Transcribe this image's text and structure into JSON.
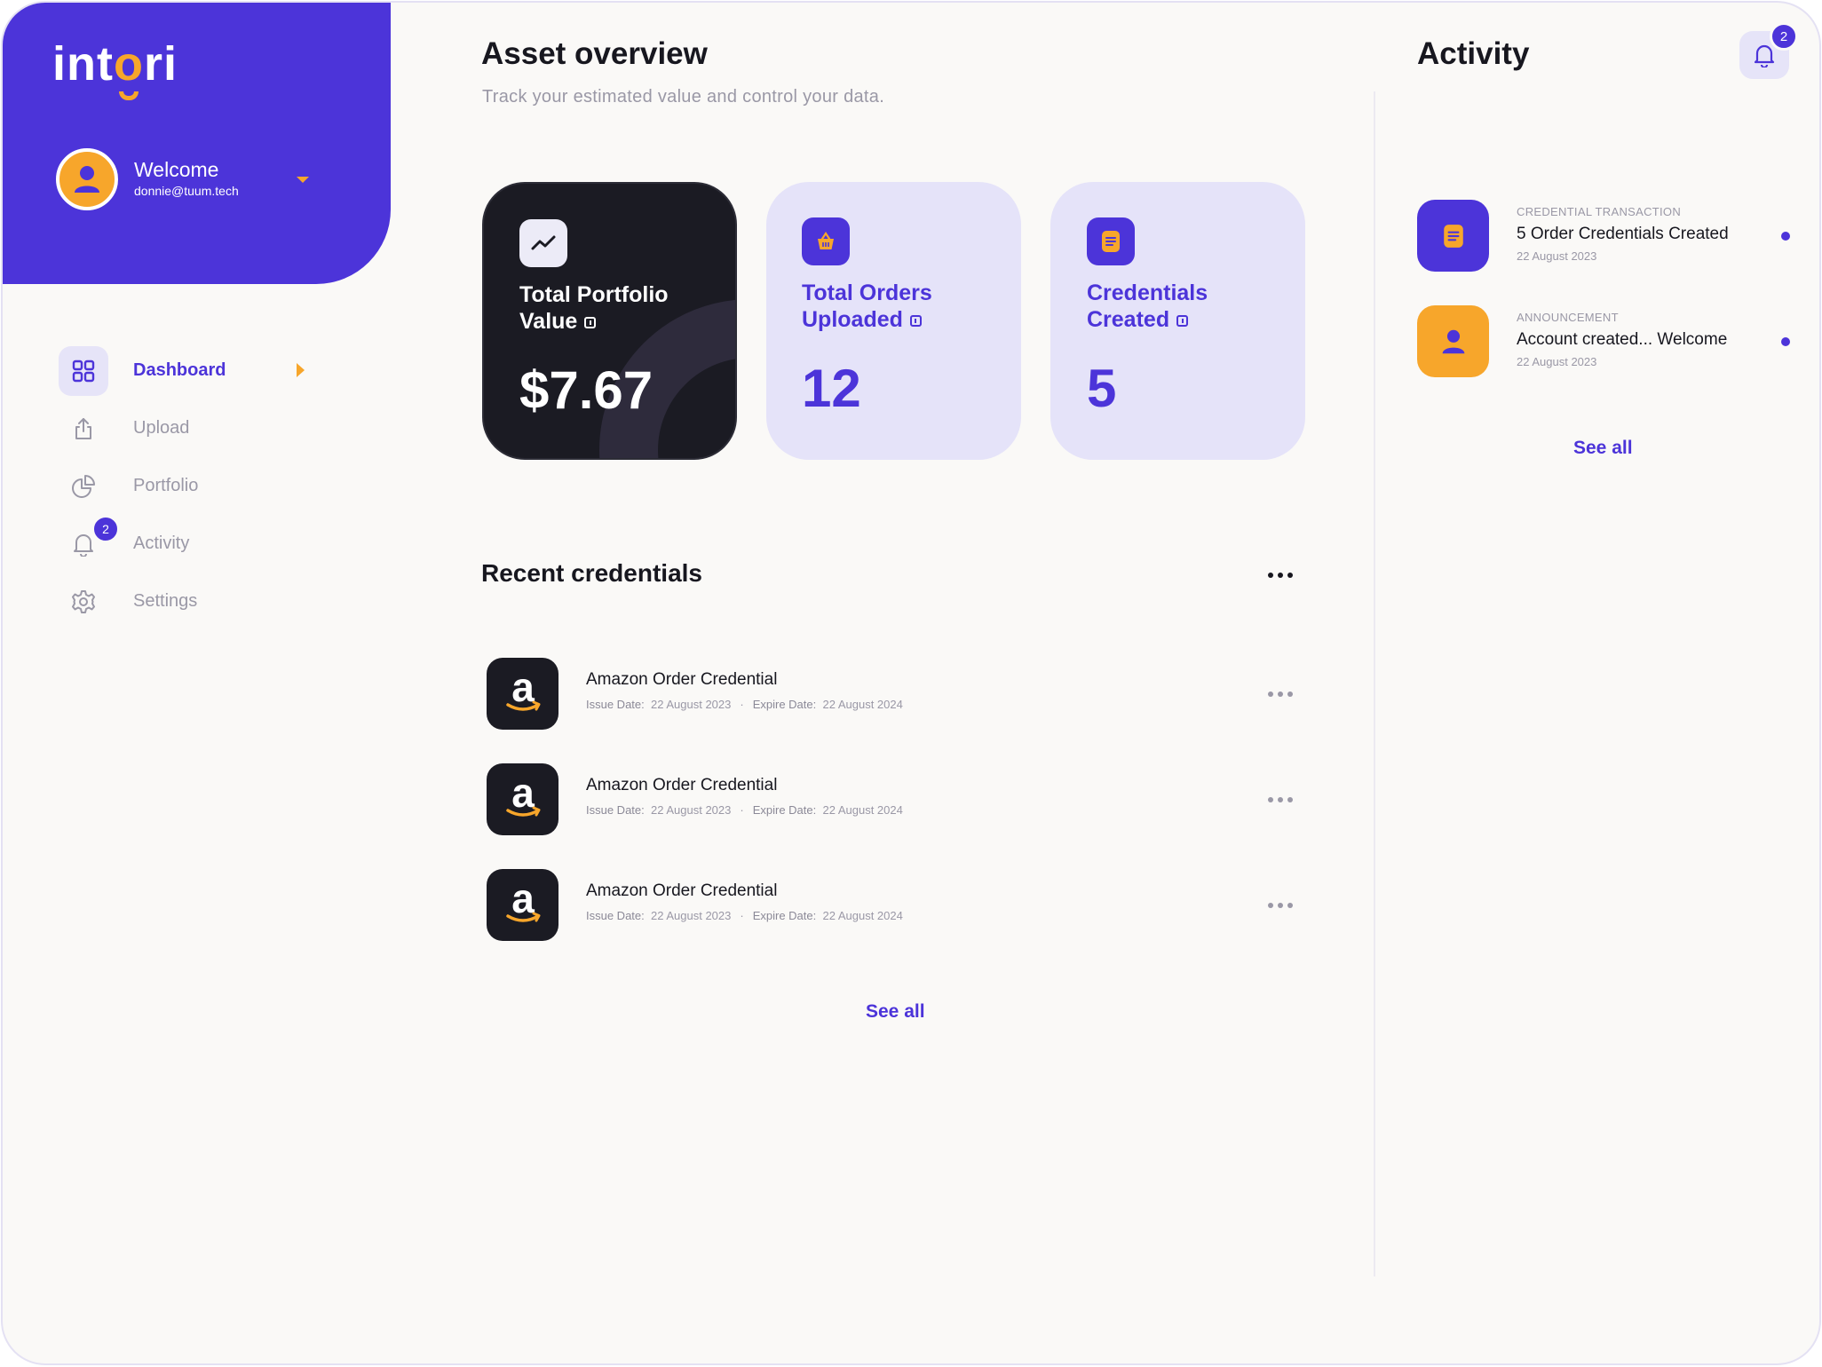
{
  "brand": {
    "logo_pre": "int",
    "logo_o": "o",
    "logo_post": "ri"
  },
  "user": {
    "welcome": "Welcome",
    "email": "donnie@tuum.tech"
  },
  "nav": [
    {
      "label": "Dashboard",
      "icon": "grid-icon",
      "active": true
    },
    {
      "label": "Upload",
      "icon": "upload-icon"
    },
    {
      "label": "Portfolio",
      "icon": "pie-chart-icon"
    },
    {
      "label": "Activity",
      "icon": "bell-icon",
      "badge": "2"
    },
    {
      "label": "Settings",
      "icon": "gear-icon"
    }
  ],
  "overview": {
    "title": "Asset overview",
    "subtitle": "Track your estimated value and control your data."
  },
  "stats": [
    {
      "line1": "Total Portfolio",
      "line2": "Value",
      "value": "$7.67",
      "icon": "trend-icon"
    },
    {
      "line1": "Total Orders",
      "line2": "Uploaded",
      "value": "12",
      "icon": "basket-icon"
    },
    {
      "line1": "Credentials",
      "line2": "Created",
      "value": "5",
      "icon": "document-icon"
    }
  ],
  "recent": {
    "title": "Recent credentials",
    "see_all": "See all",
    "items": [
      {
        "name": "Amazon Order Credential",
        "issue_label": "Issue Date:",
        "issue_date": "22 August 2023",
        "expire_label": "Expire Date:",
        "expire_date": "22 August 2024"
      },
      {
        "name": "Amazon Order Credential",
        "issue_label": "Issue Date:",
        "issue_date": "22 August 2023",
        "expire_label": "Expire Date:",
        "expire_date": "22 August 2024"
      },
      {
        "name": "Amazon Order Credential",
        "issue_label": "Issue Date:",
        "issue_date": "22 August 2023",
        "expire_label": "Expire Date:",
        "expire_date": "22 August 2024"
      }
    ]
  },
  "activity": {
    "title": "Activity",
    "badge": "2",
    "see_all": "See all",
    "items": [
      {
        "category": "CREDENTIAL TRANSACTION",
        "text": "5 Order Credentials Created",
        "date": "22 August 2023",
        "icon": "document-icon",
        "color": "#4c34d9"
      },
      {
        "category": "ANNOUNCEMENT",
        "text": "Account created... Welcome",
        "date": "22 August 2023",
        "icon": "user-icon",
        "color": "#f7a62b"
      }
    ]
  },
  "colors": {
    "primary": "#4c34d9",
    "accent": "#f7a62b",
    "dark": "#1b1b23",
    "card_light": "#e5e3f9"
  }
}
